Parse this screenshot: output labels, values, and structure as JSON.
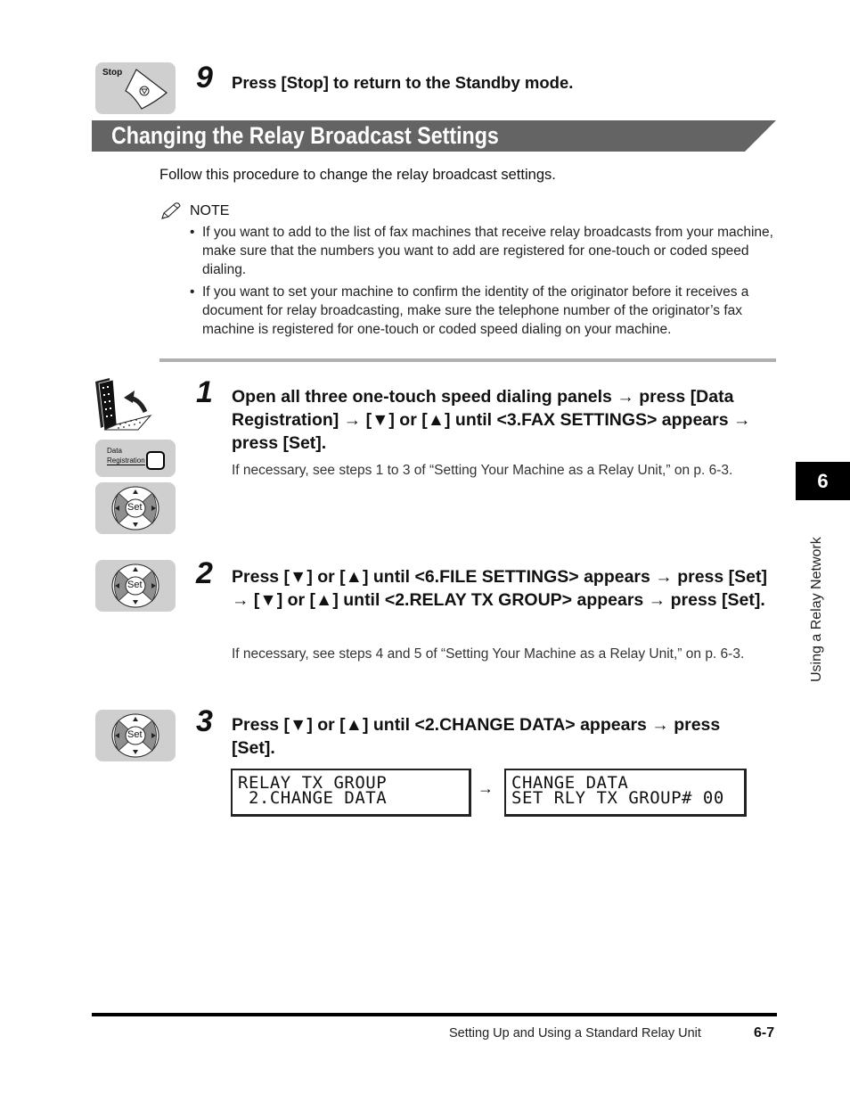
{
  "top_step": {
    "number": "9",
    "text": "Press [Stop] to return to the Standby mode.",
    "key_label": "Stop"
  },
  "section": {
    "title": "Changing the Relay Broadcast Settings",
    "intro": "Follow this procedure to change the relay broadcast settings.",
    "note_label": "NOTE",
    "note_bullets": [
      "If you want to add to the list of fax machines that receive relay broadcasts from your machine, make sure that the numbers you want to add are registered for one-touch or coded speed dialing.",
      "If you want to set your machine to confirm the identity of the originator before it receives a document for relay broadcasting, make sure the telephone number of the originator’s fax machine is registered for one-touch or coded speed dialing on your machine."
    ]
  },
  "steps": [
    {
      "number": "1",
      "title": "Open all three one-touch speed dialing panels → press [Data Registration] → [▼] or [▲] until <3.FAX SETTINGS> appears → press [Set].",
      "note": "If necessary, see steps 1 to 3 of “Setting Your Machine as a Relay Unit,” on p. 6-3.",
      "data_reg_label_1": "Data",
      "data_reg_label_2": "Registration",
      "set_label": "Set"
    },
    {
      "number": "2",
      "title": "Press [▼] or [▲] until <6.FILE SETTINGS> appears → press [Set] → [▼] or [▲] until <2.RELAY TX GROUP> appears → press [Set].",
      "note": "If necessary, see steps 4 and 5 of “Setting Your Machine as a Relay Unit,” on p. 6-3.",
      "set_label": "Set"
    },
    {
      "number": "3",
      "title": "Press [▼] or [▲] until <2.CHANGE DATA> appears → press [Set].",
      "set_label": "Set",
      "lcd_before": "RELAY TX GROUP\n 2.CHANGE DATA",
      "lcd_arrow": "→",
      "lcd_after": "CHANGE DATA\nSET RLY TX GROUP# 00"
    }
  ],
  "side_tab": {
    "chapter": "6",
    "label": "Using a Relay Network"
  },
  "footer": {
    "text": "Setting Up and Using a Standard Relay Unit",
    "page": "6-7"
  },
  "colors": {
    "heading_bar": "#646464",
    "key_bg": "#cfcfcf",
    "separator": "#b0b0b0"
  }
}
